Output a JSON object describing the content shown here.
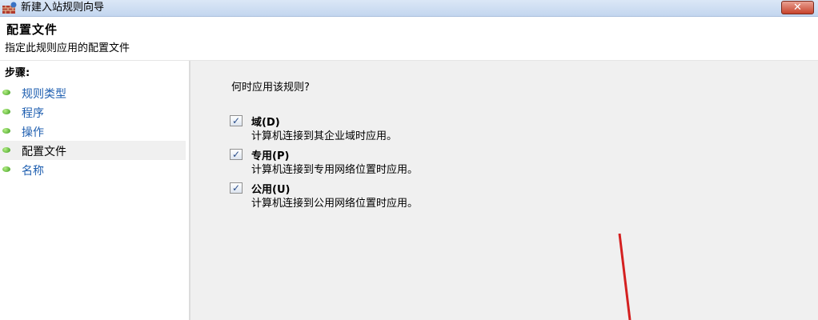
{
  "window": {
    "title": "新建入站规则向导",
    "close_label": "✕"
  },
  "header": {
    "title": "配置文件",
    "subtitle": "指定此规则应用的配置文件"
  },
  "sidebar": {
    "steps_label": "步骤:",
    "items": [
      {
        "label": "规则类型"
      },
      {
        "label": "程序"
      },
      {
        "label": "操作"
      },
      {
        "label": "配置文件"
      },
      {
        "label": "名称"
      }
    ]
  },
  "main": {
    "question": "何时应用该规则?",
    "options": [
      {
        "label": "域(D)",
        "description": "计算机连接到其企业域时应用。",
        "checked": true
      },
      {
        "label": "专用(P)",
        "description": "计算机连接到专用网络位置时应用。",
        "checked": true
      },
      {
        "label": "公用(U)",
        "description": "计算机连接到公用网络位置时应用。",
        "checked": true
      }
    ],
    "check_mark": "✓"
  },
  "colors": {
    "annotation_arrow": "#d42020",
    "link_text": "#1f5fb0",
    "main_bg": "#f0f0f0"
  }
}
